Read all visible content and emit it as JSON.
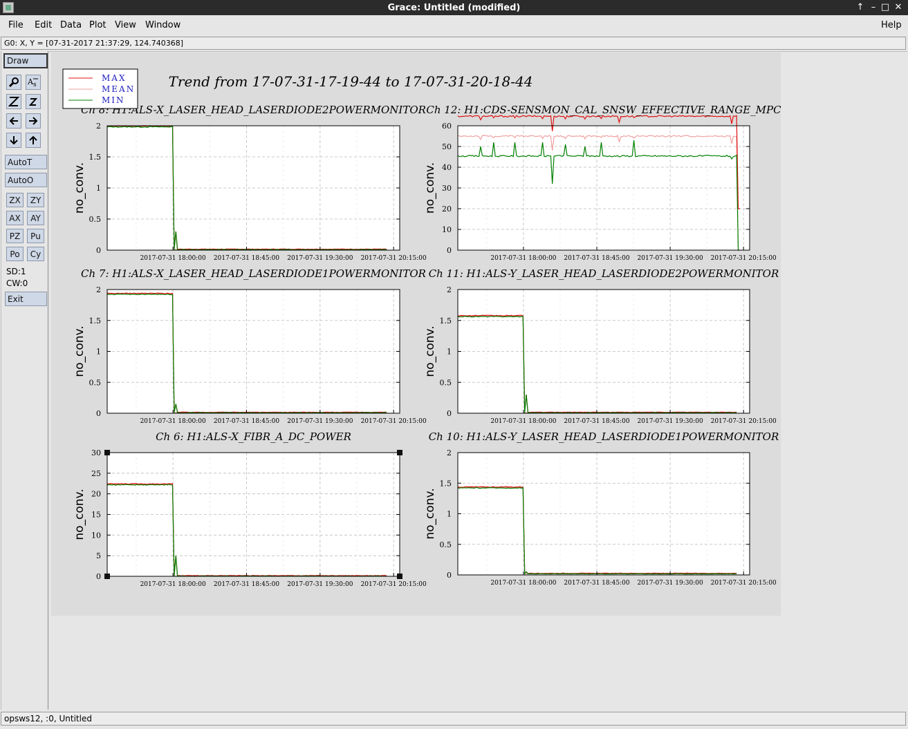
{
  "window": {
    "title": "Grace: Untitled (modified)",
    "buttons": [
      "↑",
      "–",
      "□",
      "✕"
    ]
  },
  "menubar": {
    "items": [
      {
        "label": "File",
        "mnemonic": "F"
      },
      {
        "label": "Edit",
        "mnemonic": "E"
      },
      {
        "label": "Data",
        "mnemonic": "D"
      },
      {
        "label": "Plot",
        "mnemonic": "P"
      },
      {
        "label": "View",
        "mnemonic": "V"
      },
      {
        "label": "Window",
        "mnemonic": "W"
      }
    ],
    "help": "Help"
  },
  "coord_readout": "G0: X, Y = [07-31-2017 21:37:29, 124.740368]",
  "toolbox": {
    "draw": "Draw",
    "icons": [
      "magnifier-icon",
      "text-a-icon",
      "zoom-z-icon",
      "zoom-z-small-icon",
      "arrow-left-icon",
      "arrow-right-icon",
      "arrow-down-icon",
      "arrow-up-icon"
    ],
    "autot": "AutoT",
    "autoo": "AutoO",
    "grid_buttons": [
      "ZX",
      "ZY",
      "AX",
      "AY",
      "PZ",
      "Pu",
      "Po",
      "Cy"
    ],
    "sd": "SD:1",
    "cw": "CW:0",
    "exit": "Exit"
  },
  "status": "opsws12, :0, Untitled",
  "colors": {
    "max": "#e01010",
    "mean": "#f0a0a0",
    "min": "#008000",
    "legend_text": "#2020c0"
  },
  "chart_data": {
    "type": "line",
    "title": "Trend from 17-07-31-17-19-44 to 17-07-31-20-18-44",
    "legend": [
      {
        "name": "MAX",
        "color": "#e01010"
      },
      {
        "name": "MEAN",
        "color": "#f0a0a0"
      },
      {
        "name": "MIN",
        "color": "#008000"
      }
    ],
    "legend_position": "top-left",
    "x_tick_labels": [
      "2017-07-31 18:00:00",
      "2017-07-31 18:45:00",
      "2017-07-31 19:30:00",
      "2017-07-31 20:15:00"
    ],
    "x_range": [
      "2017-07-31 17:19:44",
      "2017-07-31 20:18:44"
    ],
    "grid": true,
    "panels": [
      {
        "title": "Ch 8: H1:ALS-X_LASER_HEAD_LASERDIODE2POWERMONITOR",
        "ylabel": "no_conv.",
        "ylim": [
          0,
          2
        ],
        "yticks": [
          0,
          0.5,
          1,
          1.5,
          2
        ],
        "ytick_labels": [
          "0",
          "0.5",
          "1",
          "1.5",
          "2"
        ],
        "drop_minute": 41,
        "before": 1.99,
        "after": 0.005,
        "spikes": [
          [
            41.5,
            1.8
          ],
          [
            42.0,
            0.3
          ]
        ]
      },
      {
        "title": "Ch 12: H1:CDS-SENSMON_CAL_SNSW_EFFECTIVE_RANGE_MPC",
        "ylabel": "no_conv.",
        "ylim": [
          0,
          60
        ],
        "yticks": [
          0,
          10,
          20,
          30,
          40,
          50,
          60
        ],
        "ytick_labels": [
          "0",
          "10",
          "20",
          "30",
          "40",
          "50",
          "60"
        ],
        "baseline": 55,
        "end_drop_minute": 172,
        "dips": [
          [
            14,
            50
          ],
          [
            22,
            52
          ],
          [
            35,
            52
          ],
          [
            52,
            52
          ],
          [
            58,
            32
          ],
          [
            66,
            51
          ],
          [
            78,
            50
          ],
          [
            88,
            52
          ],
          [
            99,
            45
          ],
          [
            108,
            53
          ],
          [
            168,
            44
          ]
        ]
      },
      {
        "title": "Ch 7: H1:ALS-X_LASER_HEAD_LASERDIODE1POWERMONITOR",
        "ylabel": "no_conv.",
        "ylim": [
          0,
          2
        ],
        "yticks": [
          0,
          0.5,
          1,
          1.5,
          2
        ],
        "ytick_labels": [
          "0",
          "0.5",
          "1",
          "1.5",
          "2"
        ],
        "drop_minute": 41,
        "before": 1.93,
        "after": 0.005,
        "spikes": [
          [
            41.5,
            1.8
          ],
          [
            42.0,
            0.15
          ]
        ]
      },
      {
        "title": "Ch 11: H1:ALS-Y_LASER_HEAD_LASERDIODE2POWERMONITOR",
        "ylabel": "no_conv.",
        "ylim": [
          0,
          2
        ],
        "yticks": [
          0,
          0.5,
          1,
          1.5,
          2
        ],
        "ytick_labels": [
          "0",
          "0.5",
          "1",
          "1.5",
          "2"
        ],
        "drop_minute": 41,
        "before": 1.57,
        "after": 0.005,
        "spikes": [
          [
            41.5,
            1.5
          ],
          [
            42.0,
            0.3
          ]
        ]
      },
      {
        "title": "Ch 6: H1:ALS-X_FIBR_A_DC_POWER",
        "ylabel": "no_conv.",
        "ylim": [
          0,
          30
        ],
        "yticks": [
          0,
          5,
          10,
          15,
          20,
          25,
          30
        ],
        "ytick_labels": [
          "0",
          "5",
          "10",
          "15",
          "20",
          "25",
          "30"
        ],
        "drop_minute": 41,
        "before": 22.3,
        "after": 0.0,
        "spikes": [
          [
            41.5,
            20
          ],
          [
            42.0,
            5
          ]
        ]
      },
      {
        "title": "Ch 10: H1:ALS-Y_LASER_HEAD_LASERDIODE1POWERMONITOR",
        "ylabel": "no_conv.",
        "ylim": [
          0,
          2
        ],
        "yticks": [
          0,
          0.5,
          1,
          1.5,
          2
        ],
        "ytick_labels": [
          "0",
          "0.5",
          "1",
          "1.5",
          "2"
        ],
        "drop_minute": 41,
        "before": 1.43,
        "after": 0.015,
        "spikes": [
          [
            41.5,
            1.3
          ],
          [
            42.0,
            0.05
          ]
        ]
      }
    ]
  }
}
